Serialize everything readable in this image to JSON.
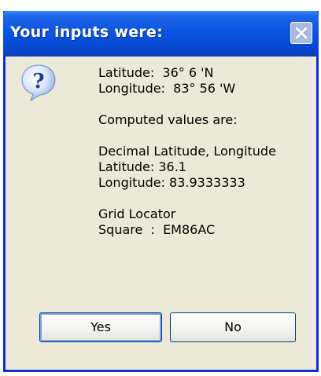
{
  "dialog": {
    "title": "Your inputs were:",
    "icon": "question-icon",
    "lines": {
      "latitude_input": "Latitude:  36° 6 'N",
      "longitude_input": "Longitude:  83° 56 'W",
      "computed_heading": "Computed values are:",
      "decimal_heading": "Decimal Latitude, Longitude",
      "latitude_decimal": "Latitude: 36.1",
      "longitude_decimal": "Longitude: 83.9333333",
      "grid_heading": "Grid Locator",
      "grid_square": "Square  :  EM86AC"
    },
    "buttons": {
      "yes": "Yes",
      "no": "No"
    }
  },
  "colors": {
    "titlebar": "#0a55e0",
    "frame": "#0831d9",
    "body": "#ece9d8",
    "close_button": "#a9b9e0"
  }
}
